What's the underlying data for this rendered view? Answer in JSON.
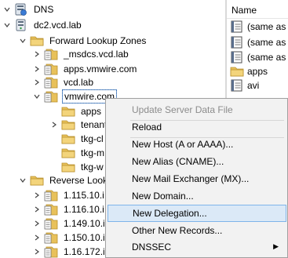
{
  "tree": {
    "root": "DNS",
    "server": "dc2.vcd.lab",
    "forward_zones": "Forward Lookup Zones",
    "zones": [
      "_msdcs.vcd.lab",
      "apps.vmwire.com",
      "vcd.lab"
    ],
    "selected_zone": "vmwire.com",
    "subzones": [
      "apps",
      "tenant",
      "tkg-cl",
      "tkg-m",
      "tkg-w"
    ],
    "reverse_zones": "Reverse Look",
    "reverse_items": [
      "1.115.10.i",
      "1.116.10.i",
      "1.149.10.i",
      "1.150.10.i",
      "1.16.172.i"
    ]
  },
  "list": {
    "header": "Name",
    "rows": [
      "(same as p",
      "(same as p",
      "(same as p",
      "apps",
      "avi"
    ]
  },
  "menu": {
    "items": [
      {
        "label": "Update Server Data File",
        "disabled": true
      },
      {
        "label": "Reload"
      },
      {
        "label": "New Host (A or AAAA)..."
      },
      {
        "label": "New Alias (CNAME)..."
      },
      {
        "label": "New Mail Exchanger (MX)..."
      },
      {
        "label": "New Domain..."
      },
      {
        "label": "New Delegation...",
        "highlighted": true
      },
      {
        "label": "Other New Records..."
      },
      {
        "label": "DNSSEC",
        "submenu": true
      }
    ]
  },
  "colors": {
    "folder": "#e8c15a",
    "highlight_bg": "#dbe9f7",
    "highlight_border": "#7eb4ea"
  }
}
